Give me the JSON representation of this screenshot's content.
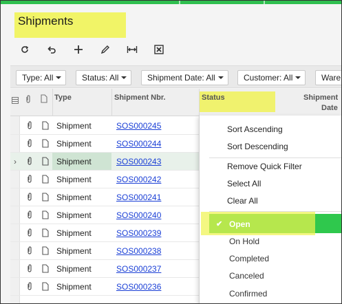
{
  "page": {
    "title": "Shipments"
  },
  "toolbar": {
    "buttons": [
      {
        "name": "refresh-icon"
      },
      {
        "name": "undo-icon"
      },
      {
        "name": "add-icon"
      },
      {
        "name": "edit-icon"
      },
      {
        "name": "fit-columns-icon"
      },
      {
        "name": "export-excel-icon"
      }
    ]
  },
  "filters": [
    "Type: All",
    "Status: All",
    "Shipment Date: All",
    "Customer: All",
    "Ware"
  ],
  "columns": {
    "type": "Type",
    "shipment_nbr": "Shipment Nbr.",
    "status": "Status",
    "shipment_date_line1": "Shipment",
    "shipment_date_line2": "Date"
  },
  "rows": [
    {
      "type": "Shipment",
      "nbr": "SOS000245"
    },
    {
      "type": "Shipment",
      "nbr": "SOS000244"
    },
    {
      "type": "Shipment",
      "nbr": "SOS000243"
    },
    {
      "type": "Shipment",
      "nbr": "SOS000242"
    },
    {
      "type": "Shipment",
      "nbr": "SOS000241"
    },
    {
      "type": "Shipment",
      "nbr": "SOS000240"
    },
    {
      "type": "Shipment",
      "nbr": "SOS000239"
    },
    {
      "type": "Shipment",
      "nbr": "SOS000238"
    },
    {
      "type": "Shipment",
      "nbr": "SOS000237"
    },
    {
      "type": "Shipment",
      "nbr": "SOS000236"
    }
  ],
  "selected_row": 2,
  "menu": {
    "sort_asc": "Sort Ascending",
    "sort_desc": "Sort Descending",
    "remove_filter": "Remove Quick Filter",
    "select_all": "Select All",
    "clear_all": "Clear All",
    "options": [
      "Open",
      "On Hold",
      "Completed",
      "Canceled",
      "Confirmed"
    ],
    "checked": "Open"
  },
  "colors": {
    "accent": "#2fc84d",
    "highlight": "#f0f34d",
    "link": "#1a3fd6"
  }
}
